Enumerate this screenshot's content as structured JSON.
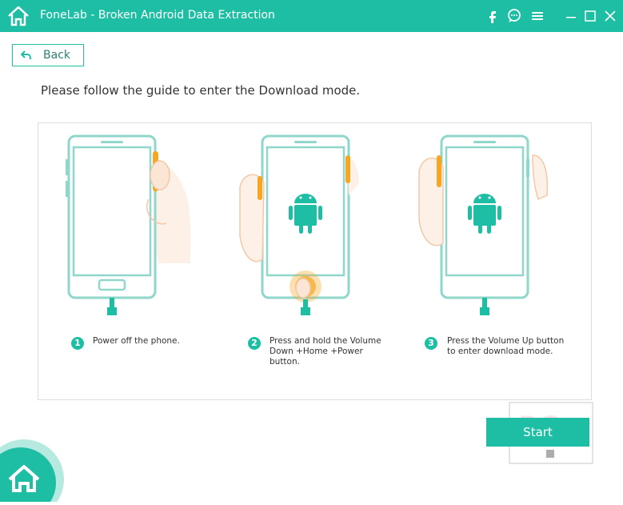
{
  "window": {
    "title": "FoneLab - Broken Android Data Extraction"
  },
  "titlebar_icons": [
    "facebook-icon",
    "chat-icon",
    "menu-icon",
    "minimize-icon",
    "maximize-icon",
    "close-icon"
  ],
  "back_button": {
    "label": "Back"
  },
  "instruction": "Please follow the guide to enter the Download mode.",
  "steps": [
    {
      "number": "1",
      "text": "Power off the phone."
    },
    {
      "number": "2",
      "text": "Press and hold the Volume\nDown +Home +Power\nbutton."
    },
    {
      "number": "3",
      "text": "Press the Volume Up button\nto enter download mode."
    }
  ],
  "start_button": {
    "label": "Start"
  },
  "colors": {
    "accent": "#1ebea5",
    "highlight": "#f5a623",
    "phone_outline": "#8fd6cb"
  }
}
